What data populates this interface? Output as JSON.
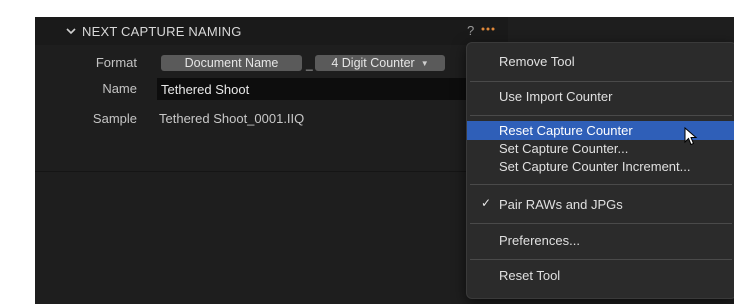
{
  "panel": {
    "title": "NEXT CAPTURE NAMING",
    "help": "?",
    "format_label": "Format",
    "name_label": "Name",
    "sample_label": "Sample",
    "tokens": [
      "Document Name",
      "4 Digit Counter"
    ],
    "token_separator": "_",
    "name_value": "Tethered Shoot",
    "sample_value": "Tethered Shoot_0001.IIQ"
  },
  "menu": {
    "items": [
      {
        "label": "Remove Tool"
      },
      {
        "label": "Use Import Counter"
      },
      {
        "label": "Reset Capture Counter",
        "highlighted": true
      },
      {
        "label": "Set Capture Counter..."
      },
      {
        "label": "Set Capture Counter Increment..."
      },
      {
        "label": "Pair RAWs and JPGs",
        "checked": true
      },
      {
        "label": "Preferences..."
      },
      {
        "label": "Reset Tool"
      }
    ],
    "check_mark": "✓"
  },
  "colors": {
    "background": "#1e1e1e",
    "menu_background": "#2b2b2b",
    "highlight": "#2f5fb8",
    "dots_accent": "#e0893a"
  },
  "icons": {
    "collapse": "chevron-down-icon",
    "more": "more-dots-icon",
    "help": "help-icon",
    "check": "check-icon",
    "cursor": "pointer-cursor-icon",
    "dropdown": "dropdown-caret-icon"
  }
}
